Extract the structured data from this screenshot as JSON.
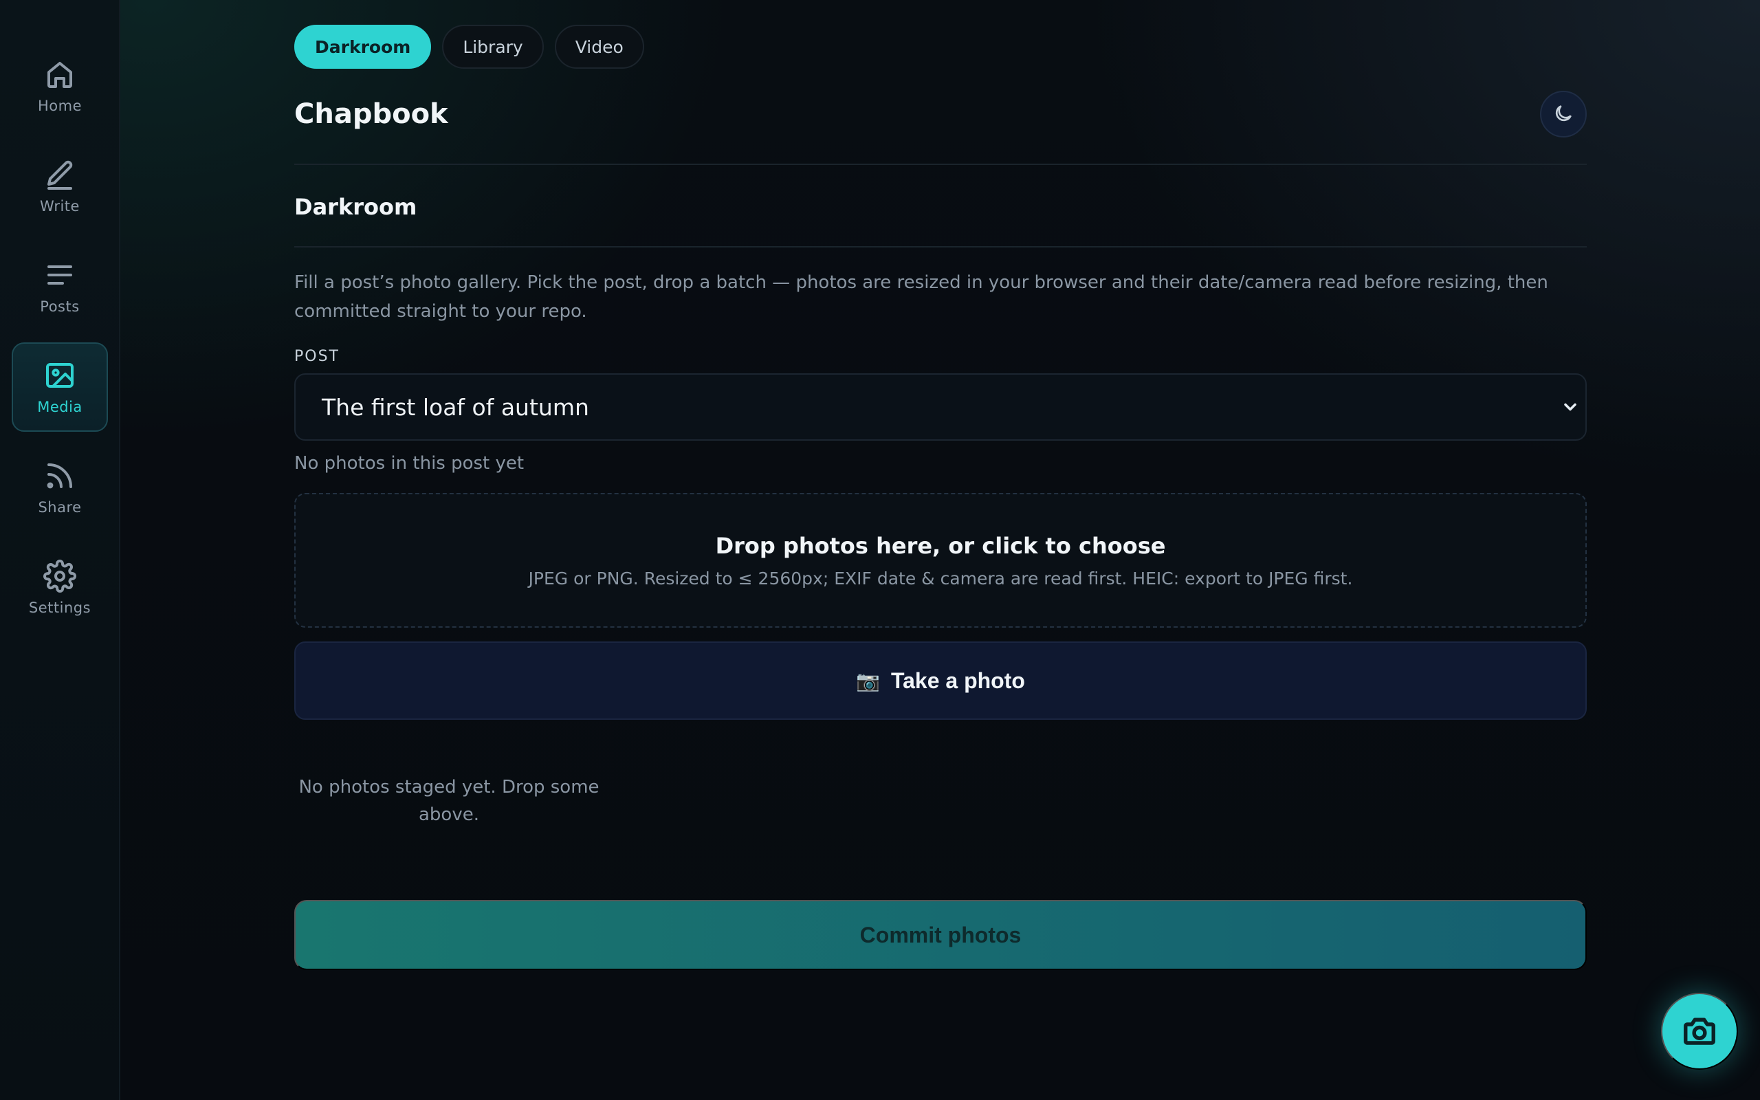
{
  "nav": {
    "items": [
      {
        "label": "Home",
        "icon": "home-icon"
      },
      {
        "label": "Write",
        "icon": "pen-icon"
      },
      {
        "label": "Posts",
        "icon": "list-icon"
      },
      {
        "label": "Media",
        "icon": "image-icon",
        "active": true
      },
      {
        "label": "Share",
        "icon": "rss-icon"
      },
      {
        "label": "Settings",
        "icon": "gear-icon"
      }
    ]
  },
  "tabs": [
    {
      "label": "Darkroom",
      "active": true
    },
    {
      "label": "Library"
    },
    {
      "label": "Video"
    }
  ],
  "header": {
    "title": "Chapbook",
    "theme_icon": "moon-icon"
  },
  "section": {
    "title": "Darkroom",
    "description": "Fill a post’s photo gallery. Pick the post, drop a batch — photos are resized in your browser and their date/camera read before resizing, then committed straight to your repo."
  },
  "post_field": {
    "label": "POST",
    "selected": "The first loaf of autumn",
    "note": "No photos in this post yet"
  },
  "dropzone": {
    "title": "Drop photos here, or click to choose",
    "subtitle": "JPEG or PNG. Resized to ≤ 2560px; EXIF date & camera are read first. HEIC: export to JPEG first."
  },
  "take_photo": {
    "emoji": "📷",
    "label": "Take a photo"
  },
  "staged": {
    "empty": "No photos staged yet. Drop some above."
  },
  "commit": {
    "label": "Commit photos"
  },
  "fab": {
    "icon": "camera-icon"
  },
  "colors": {
    "accent": "#2ed3d1",
    "background": "#080d12",
    "commit_gradient_start": "#19766f",
    "commit_gradient_end": "#155f70"
  }
}
